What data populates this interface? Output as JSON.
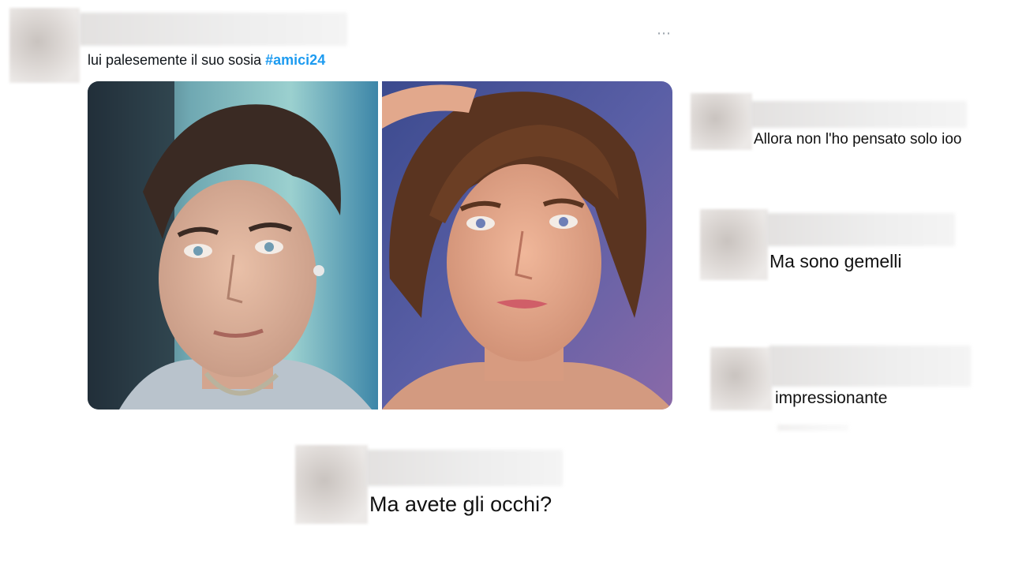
{
  "tweet": {
    "text": "lui palesemente il suo sosia",
    "hashtag": "#amici24",
    "more_icon": "⋯"
  },
  "photos": [
    {
      "icon": "portrait-photo-left"
    },
    {
      "icon": "portrait-photo-right"
    }
  ],
  "replies": [
    {
      "text": "Allora non l'ho pensato solo ioo"
    },
    {
      "text": "Ma sono gemelli"
    },
    {
      "text": "impressionante"
    },
    {
      "text": "Ma avete gli occhi?"
    }
  ],
  "colors": {
    "hashtag": "#1d9bf0",
    "text": "#0f1419"
  }
}
